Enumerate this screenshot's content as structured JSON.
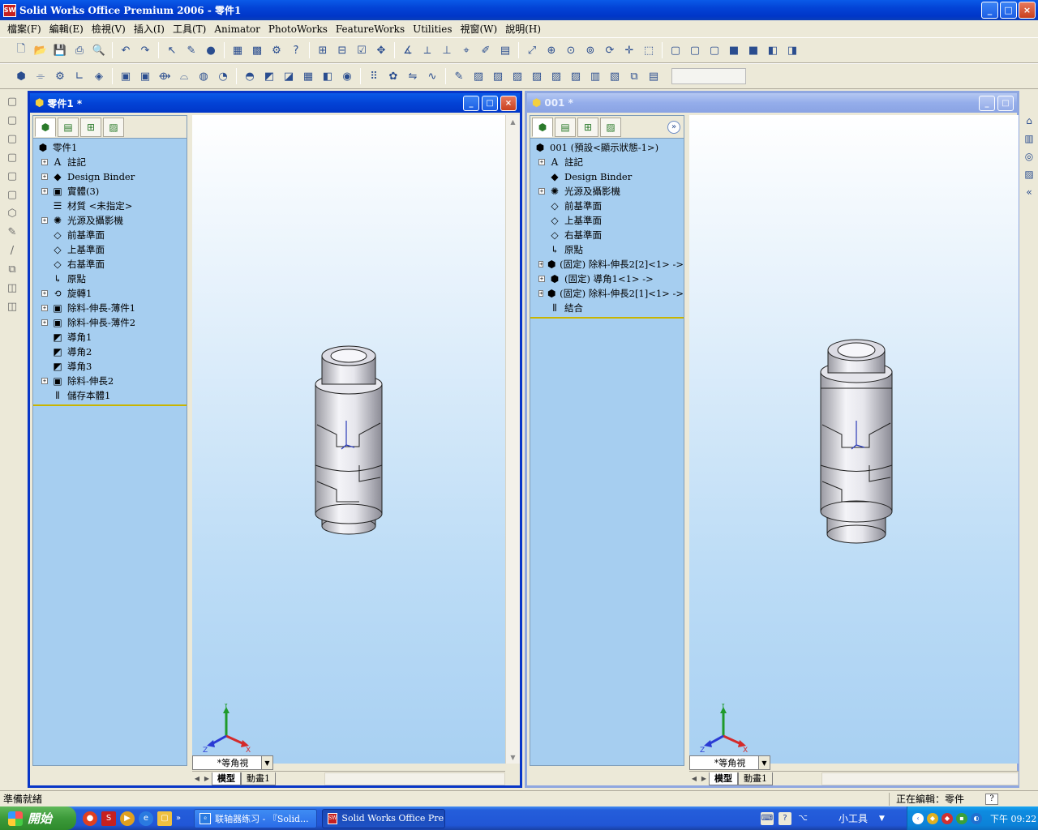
{
  "app": {
    "title": "Solid Works Office Premium 2006 - 零件1",
    "icon_label": "SW",
    "window_buttons": [
      "_",
      "□",
      "×"
    ]
  },
  "menu": [
    "檔案(F)",
    "編輯(E)",
    "檢視(V)",
    "插入(I)",
    "工具(T)",
    "Animator",
    "PhotoWorks",
    "FeatureWorks",
    "Utilities",
    "視窗(W)",
    "說明(H)"
  ],
  "left_doc": {
    "title": "零件1 *",
    "tree": [
      {
        "label": "零件1",
        "icon": "part-icon",
        "glyph": "⬢",
        "exp": false,
        "root": true
      },
      {
        "label": "註記",
        "icon": "annotation-icon",
        "glyph": "A",
        "exp": true
      },
      {
        "label": "Design Binder",
        "icon": "binder-icon",
        "glyph": "◆",
        "exp": true
      },
      {
        "label": "實體(3)",
        "icon": "solid-bodies-icon",
        "glyph": "▣",
        "exp": true
      },
      {
        "label": "材質 <未指定>",
        "icon": "material-icon",
        "glyph": "☰",
        "exp": false
      },
      {
        "label": "光源及攝影機",
        "icon": "lights-icon",
        "glyph": "✺",
        "exp": true
      },
      {
        "label": "前基準面",
        "icon": "plane-icon",
        "glyph": "◇",
        "exp": false
      },
      {
        "label": "上基準面",
        "icon": "plane-icon",
        "glyph": "◇",
        "exp": false
      },
      {
        "label": "右基準面",
        "icon": "plane-icon",
        "glyph": "◇",
        "exp": false
      },
      {
        "label": "原點",
        "icon": "origin-icon",
        "glyph": "↳",
        "exp": false
      },
      {
        "label": "旋轉1",
        "icon": "revolve-icon",
        "glyph": "⟲",
        "exp": true
      },
      {
        "label": "除料-伸長-薄件1",
        "icon": "cut-icon",
        "glyph": "▣",
        "exp": true
      },
      {
        "label": "除料-伸長-薄件2",
        "icon": "cut-icon",
        "glyph": "▣",
        "exp": true
      },
      {
        "label": "導角1",
        "icon": "chamfer-icon",
        "glyph": "◩",
        "exp": false
      },
      {
        "label": "導角2",
        "icon": "chamfer-icon",
        "glyph": "◩",
        "exp": false
      },
      {
        "label": "導角3",
        "icon": "chamfer-icon",
        "glyph": "◩",
        "exp": false
      },
      {
        "label": "除料-伸長2",
        "icon": "cut-icon",
        "glyph": "▣",
        "exp": true
      },
      {
        "label": "儲存本體1",
        "icon": "save-bodies-icon",
        "glyph": "⫴",
        "exp": false
      }
    ],
    "view": "*等角視",
    "tabs": [
      "模型",
      "動畫1"
    ]
  },
  "right_doc": {
    "title": "001 *",
    "tree": [
      {
        "label": "001 (預設<顯示狀態-1>)",
        "icon": "part-icon",
        "glyph": "⬢",
        "exp": false,
        "root": true
      },
      {
        "label": "註記",
        "icon": "annotation-icon",
        "glyph": "A",
        "exp": true
      },
      {
        "label": "Design Binder",
        "icon": "binder-icon",
        "glyph": "◆",
        "exp": false
      },
      {
        "label": "光源及攝影機",
        "icon": "lights-icon",
        "glyph": "✺",
        "exp": true
      },
      {
        "label": "前基準面",
        "icon": "plane-icon",
        "glyph": "◇",
        "exp": false
      },
      {
        "label": "上基準面",
        "icon": "plane-icon",
        "glyph": "◇",
        "exp": false
      },
      {
        "label": "右基準面",
        "icon": "plane-icon",
        "glyph": "◇",
        "exp": false
      },
      {
        "label": "原點",
        "icon": "origin-icon",
        "glyph": "↳",
        "exp": false
      },
      {
        "label": "(固定) 除料-伸長2[2]<1> ->",
        "icon": "part-feature-icon",
        "glyph": "⬢",
        "exp": true
      },
      {
        "label": "(固定) 導角1<1> ->",
        "icon": "part-feature-icon",
        "glyph": "⬢",
        "exp": true
      },
      {
        "label": "(固定) 除料-伸長2[1]<1> ->",
        "icon": "part-feature-icon",
        "glyph": "⬢",
        "exp": true
      },
      {
        "label": "結合",
        "icon": "mates-icon",
        "glyph": "⫴",
        "exp": false
      }
    ],
    "view": "*等角視",
    "tabs": [
      "模型",
      "動畫1"
    ]
  },
  "triad": {
    "x": "X",
    "y": "Y",
    "z": "Z"
  },
  "status": {
    "left": "準備就緒",
    "right": "正在編輯：零件",
    "help": "?"
  },
  "taskbar": {
    "start": "開始",
    "tasks": [
      "联轴器练习 - 『Solid...",
      "Solid Works Office Pre..."
    ],
    "gadget": "小工具",
    "clock": "下午 09:22"
  }
}
